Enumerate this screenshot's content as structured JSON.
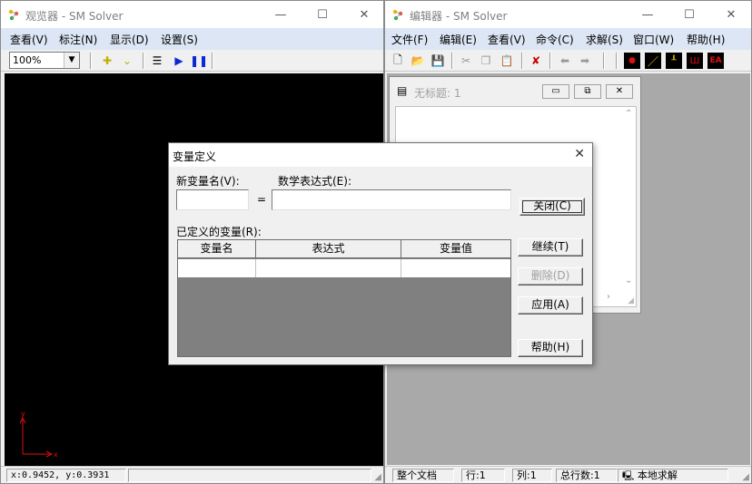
{
  "viewer": {
    "title": "观览器 - SM Solver",
    "menu": [
      "查看(V)",
      "标注(N)",
      "显示(D)",
      "设置(S)"
    ],
    "zoom": "100%",
    "axis_x": "x",
    "axis_y": "y",
    "status_coords": "x:0.9452, y:0.3931"
  },
  "editor": {
    "title": "编辑器 - SM Solver",
    "menu": [
      "文件(F)",
      "编辑(E)",
      "查看(V)",
      "命令(C)",
      "求解(S)",
      "窗口(W)",
      "帮助(H)"
    ],
    "toolbar_ea": "EA",
    "doc_title": "无标题: 1",
    "status": {
      "scope": "整个文档",
      "line": "行:1",
      "col": "列:1",
      "total_lines": "总行数:1",
      "mode": "本地求解"
    }
  },
  "dialog": {
    "title": "变量定义",
    "new_var_label": "新变量名(V):",
    "expr_label": "数学表达式(E):",
    "equals": "=",
    "defined_label": "已定义的变量(R):",
    "columns": [
      "变量名",
      "表达式",
      "变量值"
    ],
    "buttons": {
      "close": "关闭(C)",
      "continue": "继续(T)",
      "delete": "删除(D)",
      "apply": "应用(A)",
      "help": "帮助(H)"
    }
  },
  "colors": {
    "menubar": "#dce6f4",
    "canvas": "#000000",
    "mdi_bg": "#a9a9a9",
    "axis": "#e01010",
    "disabled_text": "#a0a0a0"
  }
}
